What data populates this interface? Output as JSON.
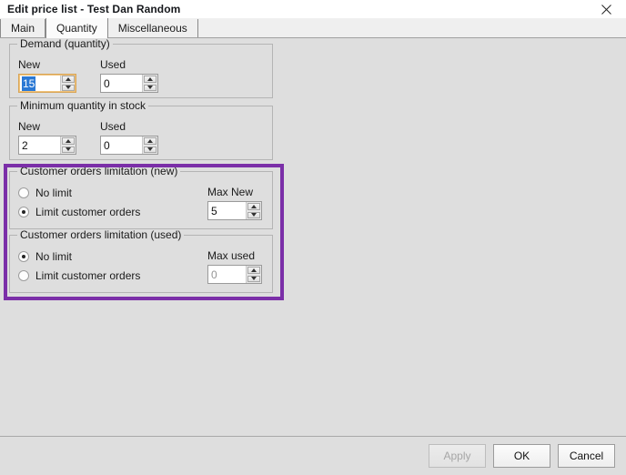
{
  "window": {
    "title": "Edit price list - Test Dan Random",
    "close_icon": "close-icon"
  },
  "tabs": [
    {
      "label": "Main",
      "selected": false
    },
    {
      "label": "Quantity",
      "selected": true
    },
    {
      "label": "Miscellaneous",
      "selected": false
    }
  ],
  "groups": {
    "demand": {
      "title": "Demand (quantity)",
      "new_label": "New",
      "new_value": "15",
      "used_label": "Used",
      "used_value": "0"
    },
    "minimum": {
      "title": "Minimum quantity in stock",
      "new_label": "New",
      "new_value": "2",
      "used_label": "Used",
      "used_value": "0"
    },
    "customer_new": {
      "title": "Customer orders limitation (new)",
      "option_no_limit": "No limit",
      "option_limit": "Limit customer orders",
      "max_label": "Max New",
      "max_value": "5"
    },
    "customer_used": {
      "title": "Customer orders limitation (used)",
      "option_no_limit": "No limit",
      "option_limit": "Limit customer orders",
      "max_label": "Max used",
      "max_value": "0"
    }
  },
  "highlight": {
    "color": "#7b2fa8"
  },
  "footer": {
    "apply_label": "Apply",
    "ok_label": "OK",
    "cancel_label": "Cancel"
  },
  "colors": {
    "background": "#dedede",
    "selection_blue": "#2a78d4",
    "focus_border": "#d8a558"
  }
}
